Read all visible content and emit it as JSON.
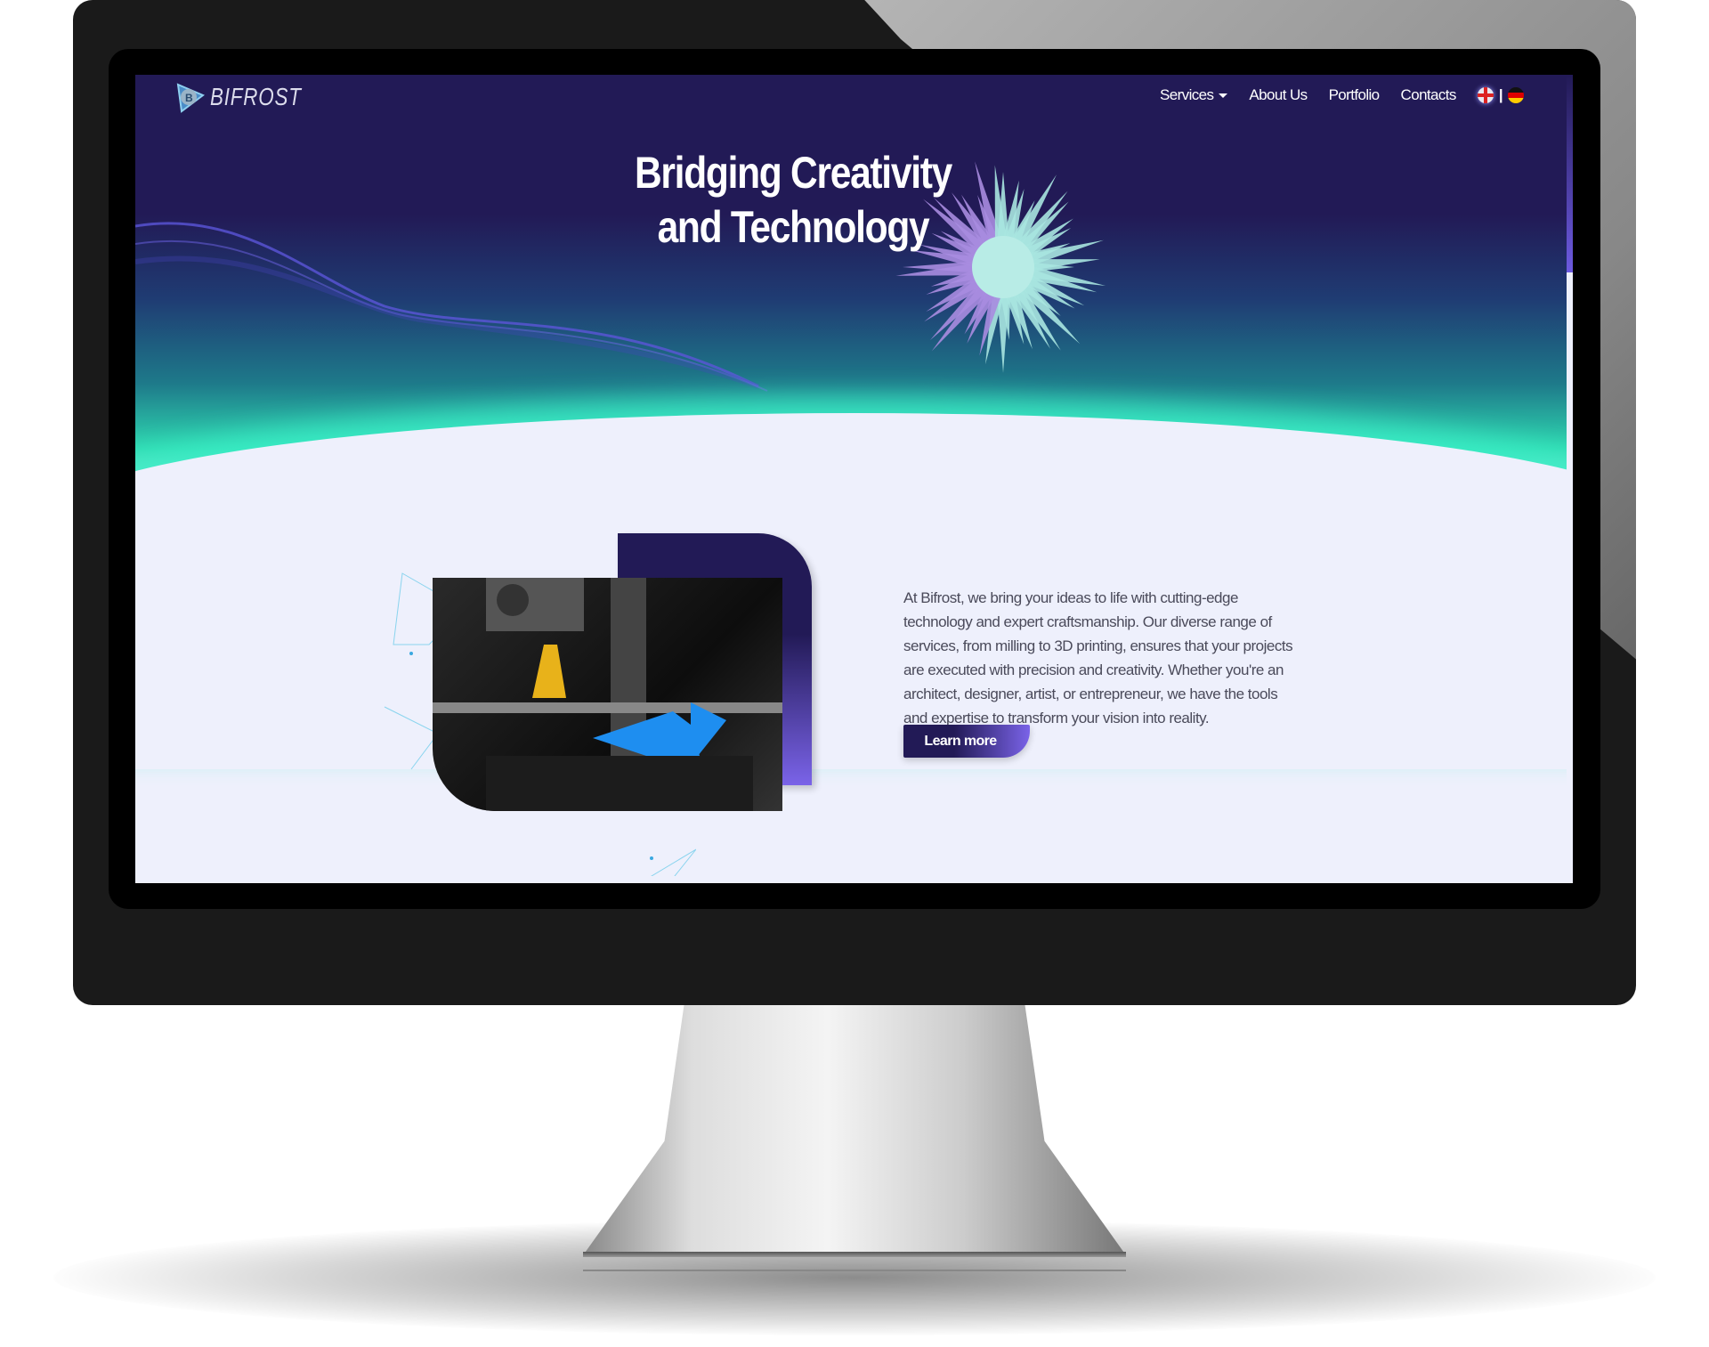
{
  "brand": {
    "name": "BIFROST",
    "logo_icon": "bifrost-logo-icon"
  },
  "nav": {
    "items": [
      {
        "label": "Services",
        "has_dropdown": true
      },
      {
        "label": "About Us"
      },
      {
        "label": "Portfolio"
      },
      {
        "label": "Contacts"
      }
    ],
    "lang_separator": "|",
    "languages": [
      "English",
      "German"
    ]
  },
  "hero": {
    "line1": "Bridging Creativity",
    "line2": "and Technology"
  },
  "about": {
    "text": "At Bifrost, we bring your ideas to life with cutting-edge technology and expert craftsmanship. Our diverse range of services, from milling to 3D printing, ensures that your projects are executed with precision and creativity. Whether you're an architect, designer, artist, or entrepreneur, we have the tools and expertise to transform your vision into reality.",
    "button": "Learn more"
  },
  "colors": {
    "primary": "#221a56",
    "accent": "#7a63e8",
    "teal": "#2fe6bd",
    "section_bg": "#eef0fc"
  }
}
